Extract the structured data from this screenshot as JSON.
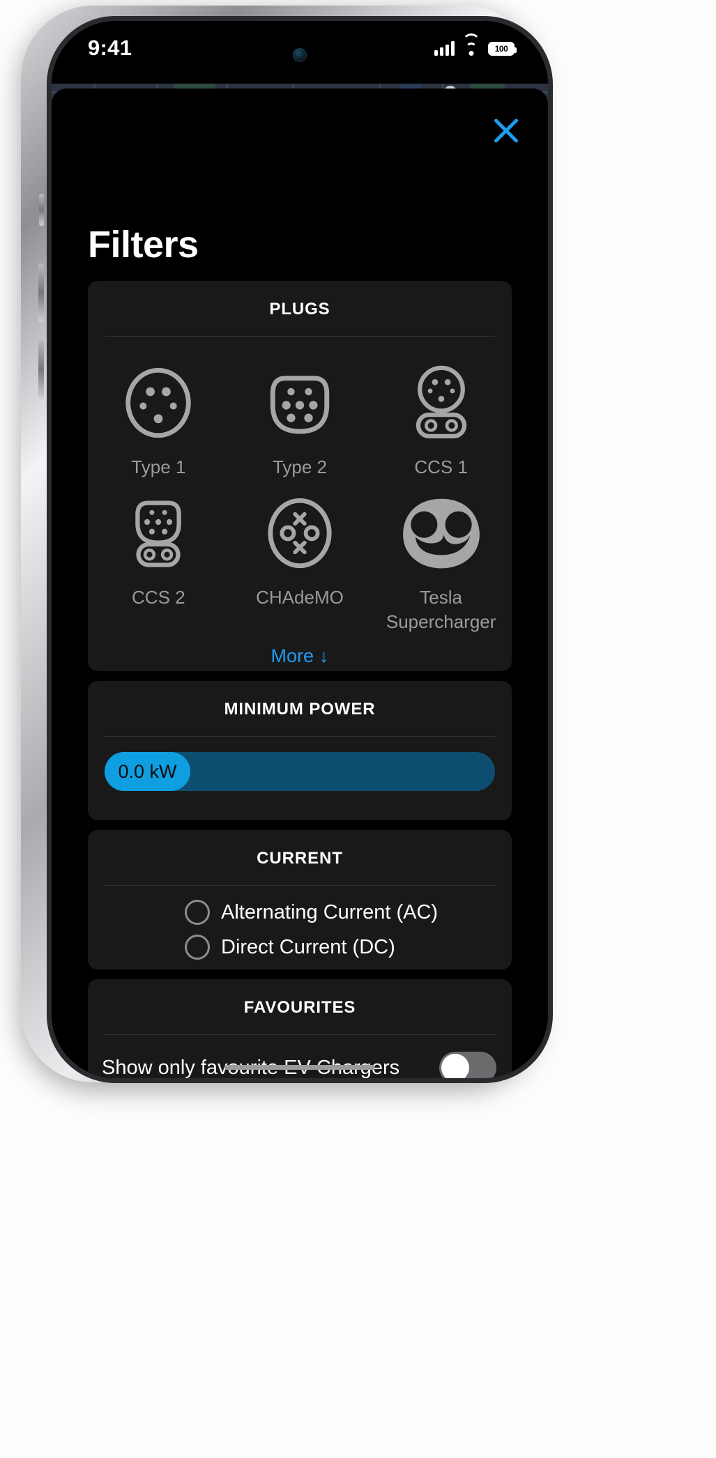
{
  "status_bar": {
    "time": "9:41",
    "battery_level": "100",
    "cellular_icon": "cellular-signal-icon",
    "wifi_icon": "wifi-icon",
    "battery_icon": "battery-icon"
  },
  "sheet": {
    "close_icon": "close-icon",
    "title": "Filters"
  },
  "plugs": {
    "header": "PLUGS",
    "items": [
      {
        "label": "Type 1",
        "icon": "plug-type1-icon"
      },
      {
        "label": "Type 2",
        "icon": "plug-type2-icon"
      },
      {
        "label": "CCS 1",
        "icon": "plug-ccs1-icon"
      },
      {
        "label": "CCS 2",
        "icon": "plug-ccs2-icon"
      },
      {
        "label": "CHAdeMO",
        "icon": "plug-chademo-icon"
      },
      {
        "label": "Tesla Supercharger",
        "icon": "plug-tesla-supercharger-icon"
      }
    ],
    "more_label": "More",
    "more_icon": "arrow-down-icon",
    "more_arrow": "↓"
  },
  "minimum_power": {
    "header": "MINIMUM POWER",
    "value_label": "0.0 kW",
    "value": 0.0,
    "unit": "kW",
    "knob_position_percent": 0,
    "track_color": "#0d4e70",
    "knob_color": "#0f9ee0"
  },
  "current": {
    "header": "CURRENT",
    "options": [
      {
        "label": "Alternating Current (AC)",
        "selected": false
      },
      {
        "label": "Direct Current (DC)",
        "selected": false
      }
    ]
  },
  "favourites": {
    "header": "FAVOURITES",
    "toggle_label": "Show only favourite EV Chargers",
    "toggle_on": false
  },
  "colors": {
    "accent": "#1e9bf0",
    "card_bg": "#191919",
    "screen_bg": "#000000",
    "label_gray": "#9b9b9b",
    "icon_gray": "#a6a6a6"
  }
}
